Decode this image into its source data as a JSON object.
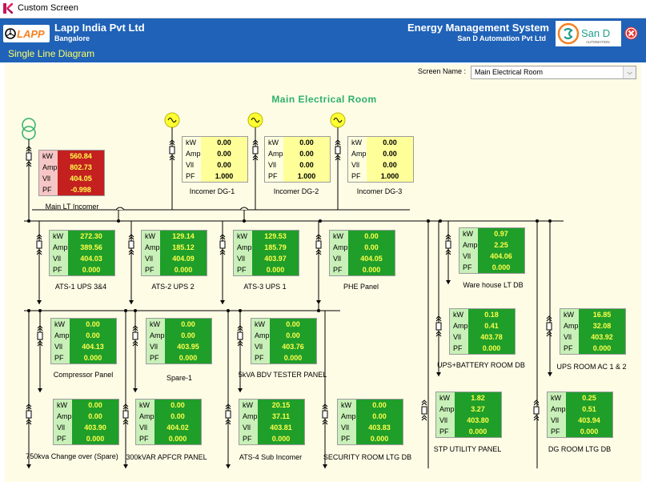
{
  "window": {
    "title": "Custom Screen"
  },
  "header": {
    "company": "Lapp India Pvt Ltd",
    "city": "Bangalore",
    "screen_title": "Single Line Diagram",
    "system": "Energy Management System",
    "vendor": "San D Automation Pvt Ltd",
    "lapp_logo_text": "LAPP",
    "sand_logo_text": "San D",
    "sand_logo_sub": "AUTOMATION",
    "accent": "#1f62b8",
    "logo_orange": "#f58220",
    "close_red": "#e53935"
  },
  "screen": {
    "label": "Screen Name :",
    "selected": "Main Electrical Room"
  },
  "diagram": {
    "title": "Main Electrical Room",
    "row_labels": [
      "kW",
      "Amp",
      "Vll",
      "PF"
    ],
    "panel_colors": {
      "normal": "#1f9e2a",
      "generator": "#ffff99",
      "alarm": "#c42020"
    },
    "feeders": [
      {
        "id": "main-lt-incomer",
        "name": "Main LT Incomer",
        "style": "red",
        "values": [
          "560.84",
          "802.73",
          "404.05",
          "-0.998"
        ]
      },
      {
        "id": "incomer-dg-1",
        "name": "Incomer DG-1",
        "style": "yellow",
        "values": [
          "0.00",
          "0.00",
          "0.00",
          "1.000"
        ]
      },
      {
        "id": "incomer-dg-2",
        "name": "Incomer DG-2",
        "style": "yellow",
        "values": [
          "0.00",
          "0.00",
          "0.00",
          "1.000"
        ]
      },
      {
        "id": "incomer-dg-3",
        "name": "Incomer DG-3",
        "style": "yellow",
        "values": [
          "0.00",
          "0.00",
          "0.00",
          "1.000"
        ]
      },
      {
        "id": "ats-1-ups",
        "name": "ATS-1 UPS 3&4",
        "style": "green",
        "values": [
          "272.30",
          "389.56",
          "404.03",
          "0.000"
        ]
      },
      {
        "id": "ats-2-ups",
        "name": "ATS-2 UPS 2",
        "style": "green",
        "values": [
          "129.14",
          "185.12",
          "404.09",
          "0.000"
        ]
      },
      {
        "id": "ats-3-ups",
        "name": "ATS-3 UPS 1",
        "style": "green",
        "values": [
          "129.53",
          "185.79",
          "403.97",
          "0.000"
        ]
      },
      {
        "id": "phe-panel",
        "name": "PHE Panel",
        "style": "green",
        "values": [
          "0.00",
          "0.00",
          "404.05",
          "0.000"
        ]
      },
      {
        "id": "warehouse-lt-db",
        "name": "Ware house LT DB",
        "style": "green",
        "values": [
          "0.97",
          "2.25",
          "404.06",
          "0.000"
        ]
      },
      {
        "id": "compressor-panel",
        "name": "Compressor Panel",
        "style": "green",
        "values": [
          "0.00",
          "0.00",
          "404.13",
          "0.000"
        ]
      },
      {
        "id": "spare-1",
        "name": "Spare-1",
        "style": "green",
        "values": [
          "0.00",
          "0.00",
          "403.95",
          "0.000"
        ]
      },
      {
        "id": "bdv-tester-panel",
        "name": "5kVA BDV TESTER PANEL",
        "style": "green",
        "values": [
          "0.00",
          "0.00",
          "403.76",
          "0.000"
        ]
      },
      {
        "id": "ups-battery-room-db",
        "name": "UPS+BATTERY ROOM DB",
        "style": "green",
        "values": [
          "0.18",
          "0.41",
          "403.78",
          "0.000"
        ]
      },
      {
        "id": "ups-room-ac",
        "name": "UPS ROOM AC 1 & 2",
        "style": "green",
        "values": [
          "16.85",
          "32.08",
          "403.92",
          "0.000"
        ]
      },
      {
        "id": "change-over-spare",
        "name": "750kva Change over (Spare)",
        "style": "green",
        "values": [
          "0.00",
          "0.00",
          "403.90",
          "0.000"
        ]
      },
      {
        "id": "apfcr-panel",
        "name": "300kVAR APFCR PANEL",
        "style": "green",
        "values": [
          "0.00",
          "0.00",
          "404.02",
          "0.000"
        ]
      },
      {
        "id": "ats-4-sub-incomer",
        "name": "ATS-4 Sub Incomer",
        "style": "green",
        "values": [
          "20.15",
          "37.11",
          "403.81",
          "0.000"
        ]
      },
      {
        "id": "security-room-ltg-db",
        "name": "SECURITY ROOM LTG DB",
        "style": "green",
        "values": [
          "0.00",
          "0.00",
          "403.83",
          "0.000"
        ]
      },
      {
        "id": "stp-utility-panel",
        "name": "STP UTILITY PANEL",
        "style": "green",
        "values": [
          "1.82",
          "3.27",
          "403.80",
          "0.000"
        ]
      },
      {
        "id": "dg-room-ltg-db",
        "name": "DG ROOM LTG DB",
        "style": "green",
        "values": [
          "0.25",
          "0.51",
          "403.94",
          "0.000"
        ]
      }
    ]
  }
}
